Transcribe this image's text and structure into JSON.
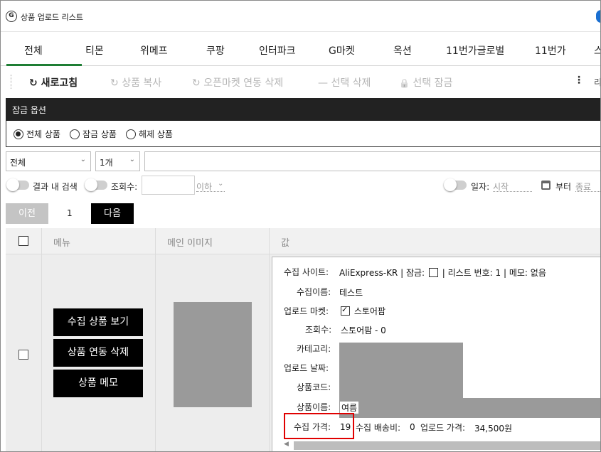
{
  "window": {
    "title": "상품 업로드 리스트",
    "app_icon_glyph": "G"
  },
  "tabs": [
    {
      "label": "전체"
    },
    {
      "label": "티몬"
    },
    {
      "label": "위메프"
    },
    {
      "label": "쿠팡"
    },
    {
      "label": "인터파크"
    },
    {
      "label": "G마켓"
    },
    {
      "label": "옥션"
    },
    {
      "label": "11번가글로벌"
    },
    {
      "label": "11번가"
    },
    {
      "label": "스"
    }
  ],
  "toolbar": {
    "refresh_icon": "↻",
    "refresh": "새로고침",
    "copy_icon": "↻",
    "copy": "상품 복사",
    "delete_link_icon": "↻",
    "delete_link": "오픈마켓 연동 삭제",
    "delete_sel_icon": "—",
    "delete_sel": "선택 삭제",
    "lock_sel_icon": "🔒",
    "lock_sel": "선택 잠금",
    "more_icon": "⋮",
    "overflow_text": "리"
  },
  "lock_options": {
    "header": "잠금 옵션",
    "options": [
      {
        "label": "전체 상품"
      },
      {
        "label": "잠금 상품"
      },
      {
        "label": "해제 상품"
      }
    ]
  },
  "filters": {
    "category_select": "전체",
    "count_select": "1개",
    "chevron": "⌄",
    "search_in_results": "결과 내 검색",
    "views_label": "조회수:",
    "views_cond": "이하",
    "date_label": "일자:",
    "date_start": "시작",
    "date_from": "부터",
    "date_end": "종료"
  },
  "pager": {
    "prev": "이전",
    "page": "1",
    "next": "다음"
  },
  "grid": {
    "headers": {
      "menu": "메뉴",
      "image": "메인 이미지",
      "value": "값"
    }
  },
  "row": {
    "actions": {
      "view": "수집 상품 보기",
      "unlink": "상품 연동 삭제",
      "memo": "상품 메모"
    },
    "details": {
      "site_label": "수집 사이트:",
      "site_value": "AliExpress-KR",
      "lock_label": "| 잠금:",
      "list_no_label": "| 리스트 번호:",
      "list_no_value": "1",
      "memo_label": "| 메모:",
      "memo_value": "없음",
      "name_label": "수집이름:",
      "name_value": "테스트",
      "market_label": "업로드 마켓:",
      "market_value": "스토어팜",
      "views_label": "조회수:",
      "views_value": "스토어팜  -  0",
      "category_label": "카테고리:",
      "upload_date_label": "업로드 날짜:",
      "product_code_label": "상품코드:",
      "product_name_label": "상품이름:",
      "product_name_value": "여름",
      "price_label": "수집 가격:",
      "price_value": "19",
      "shipping_label": "수집 배송비:",
      "shipping_value": "0",
      "upload_price_label": "업로드 가격:",
      "upload_price_value": "34,500원",
      "scroll_left_icon": "◀"
    }
  }
}
